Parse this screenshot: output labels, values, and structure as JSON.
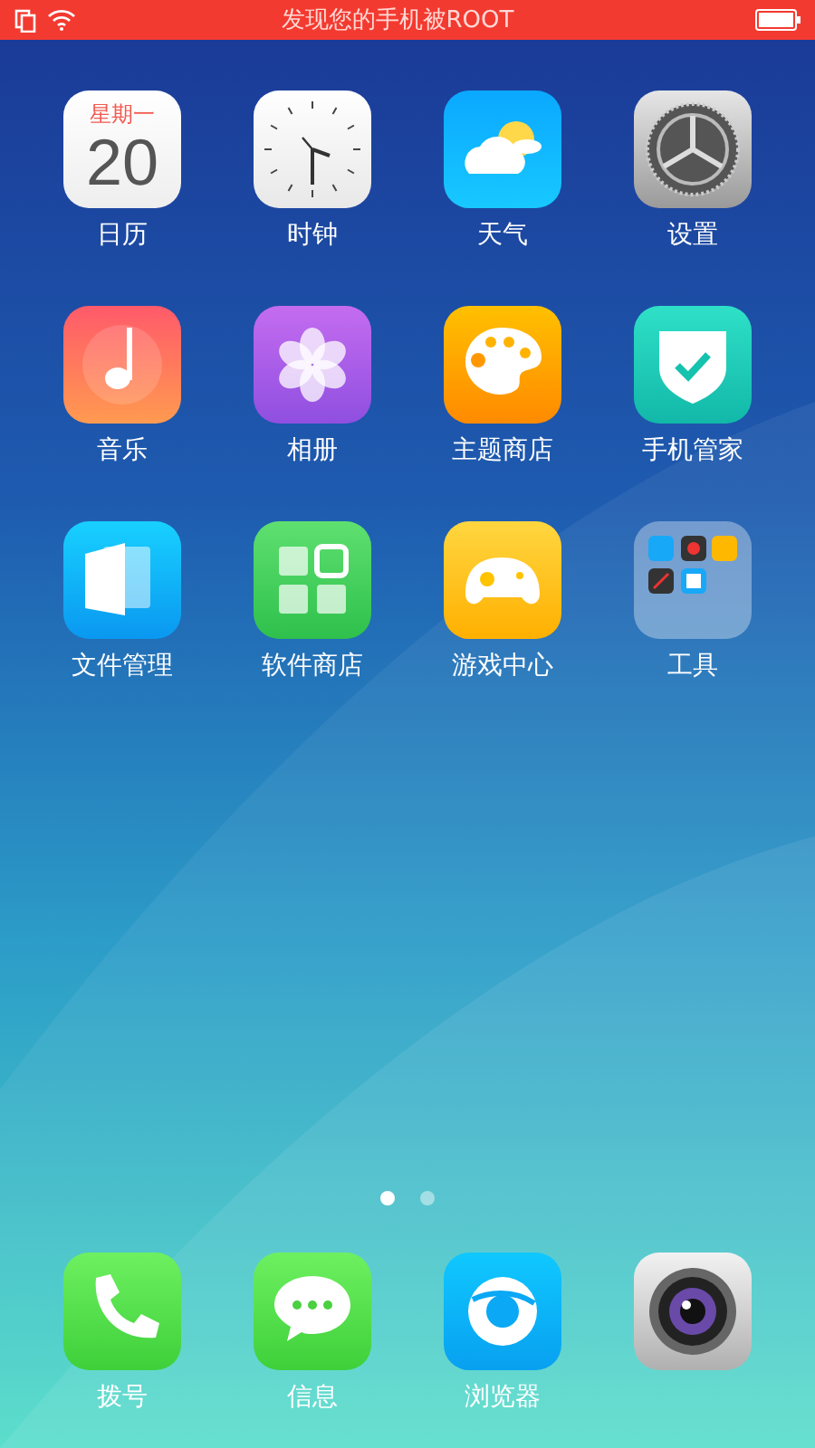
{
  "status_bar": {
    "notice": "发现您的手机被ROOT"
  },
  "apps": [
    {
      "kind": "calendar",
      "label": "日历",
      "weekday": "星期一",
      "day": "20"
    },
    {
      "kind": "clock",
      "label": "时钟"
    },
    {
      "kind": "weather",
      "label": "天气"
    },
    {
      "kind": "settings",
      "label": "设置"
    },
    {
      "kind": "music",
      "label": "音乐"
    },
    {
      "kind": "photos",
      "label": "相册"
    },
    {
      "kind": "themes",
      "label": "主题商店"
    },
    {
      "kind": "security",
      "label": "手机管家"
    },
    {
      "kind": "files",
      "label": "文件管理"
    },
    {
      "kind": "store",
      "label": "软件商店"
    },
    {
      "kind": "games",
      "label": "游戏中心"
    },
    {
      "kind": "folder",
      "label": "工具"
    }
  ],
  "pages": [
    {
      "selected": true
    },
    {
      "selected": false
    }
  ],
  "dock": [
    {
      "kind": "phone",
      "label": "拨号"
    },
    {
      "kind": "messages",
      "label": "信息"
    },
    {
      "kind": "browser",
      "label": "浏览器"
    },
    {
      "kind": "camera"
    }
  ]
}
